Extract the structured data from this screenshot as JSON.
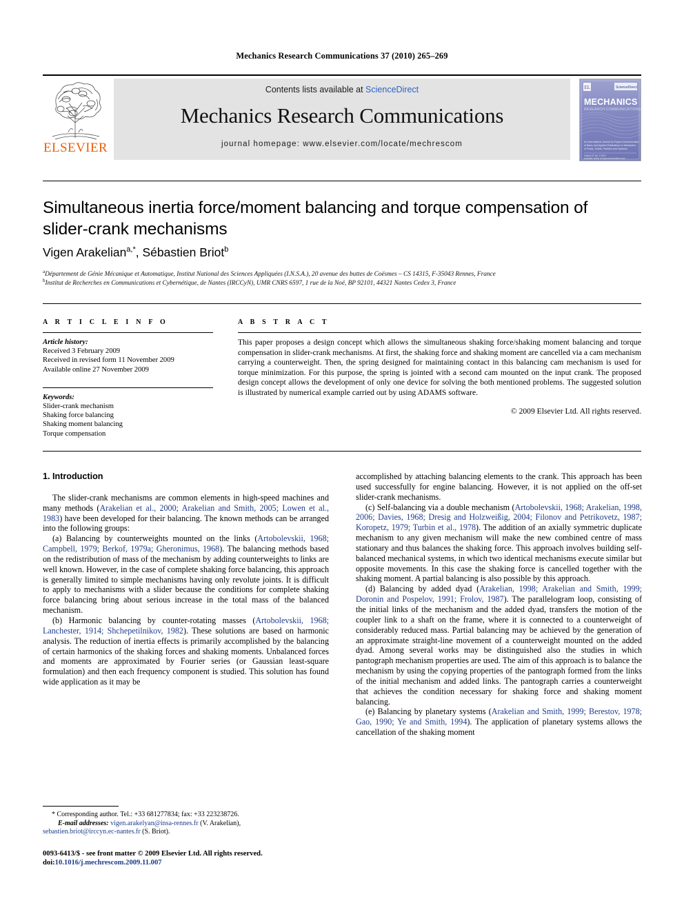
{
  "running_head": "Mechanics Research Communications 37 (2010) 265–269",
  "masthead": {
    "contents_prefix": "Contents lists available at ",
    "sciencedirect": "ScienceDirect",
    "journal_title": "Mechanics Research Communications",
    "homepage": "journal homepage: www.elsevier.com/locate/mechrescom",
    "publisher": "ELSEVIER",
    "cover": {
      "title": "MECHANICS",
      "subtitle": "RESEARCH COMMUNICATIONS",
      "blurb": "An International Journal for Rapid Communication of Basic and Applied Publications in Mechanics of Fluids, Solids, Particles and Systems",
      "badge": "ScienceDirect"
    },
    "accent_color": "#e8610a",
    "link_color": "#2b62c4",
    "band_color": "#e3e3e3"
  },
  "title": "Simultaneous inertia force/moment balancing and torque compensation of slider-crank mechanisms",
  "authors": {
    "author1": "Vigen Arakelian",
    "author1_sup": "a,*",
    "separator": ", ",
    "author2": "Sébastien Briot",
    "author2_sup": "b"
  },
  "affiliations": [
    {
      "marker": "a",
      "text": "Département de Génie Mécanique et Automatique, Institut National des Sciences Appliquées (I.N.S.A.), 20 avenue des buttes de Coësmes – CS 14315, F-35043 Rennes, France"
    },
    {
      "marker": "b",
      "text": "Institut de Recherches en Communications et Cybernétique, de Nantes (IRCCyN), UMR CNRS 6597, 1 rue de la Noë, BP 92101, 44321 Nantes Cedex 3, France"
    }
  ],
  "article_info": {
    "heading": "A R T I C L E   I N F O",
    "history_label": "Article history:",
    "history": [
      "Received 3 February 2009",
      "Received in revised form 11 November 2009",
      "Available online 27 November 2009"
    ],
    "keywords_label": "Keywords:",
    "keywords": [
      "Slider-crank mechanism",
      "Shaking force balancing",
      "Shaking moment balancing",
      "Torque compensation"
    ]
  },
  "abstract": {
    "heading": "A B S T R A C T",
    "text": "This paper proposes a design concept which allows the simultaneous shaking force/shaking moment balancing and torque compensation in slider-crank mechanisms. At first, the shaking force and shaking moment are cancelled via a cam mechanism carrying a counterweight. Then, the spring designed for maintaining contact in this balancing cam mechanism is used for torque minimization. For this purpose, the spring is jointed with a second cam mounted on the input crank. The proposed design concept allows the development of only one device for solving the both mentioned problems. The suggested solution is illustrated by numerical example carried out by using ADAMS software.",
    "copyright": "© 2009 Elsevier Ltd. All rights reserved."
  },
  "body": {
    "section_title": "1. Introduction",
    "left_column": [
      {
        "indent": true,
        "runs": [
          {
            "t": "The slider-crank mechanisms are common elements in high-speed machines and many methods ("
          },
          {
            "t": "Arakelian et al., 2000; Arakelian and Smith, 2005; Lowen et al., 1983",
            "ref": true
          },
          {
            "t": ") have been developed for their balancing. The known methods can be arranged into the following groups:"
          }
        ]
      },
      {
        "indent": true,
        "runs": [
          {
            "t": "(a) Balancing by counterweights mounted on the links ("
          },
          {
            "t": "Artobolevskii, 1968; Campbell, 1979; Berkof, 1979a; Gheronimus, 1968",
            "ref": true
          },
          {
            "t": "). The balancing methods based on the redistribution of mass of the mechanism by adding counterweights to links are well known. However, in the case of complete shaking force balancing, this approach is generally limited to simple mechanisms having only revolute joints. It is difficult to apply to mechanisms with a slider because the conditions for complete shaking force balancing bring about serious increase in the total mass of the balanced mechanism."
          }
        ]
      },
      {
        "indent": true,
        "runs": [
          {
            "t": "(b) Harmonic balancing by counter-rotating masses ("
          },
          {
            "t": "Artobolevskii, 1968; Lanchester, 1914; Shchepetilnikov, 1982",
            "ref": true
          },
          {
            "t": "). These solutions are based on harmonic analysis. The reduction of inertia effects is primarily accomplished by the balancing of certain harmonics of the shaking forces and shaking moments. Unbalanced forces and moments are approximated by Fourier series (or Gaussian least-square formulation) and then each frequency component is studied. This solution has found wide application as it may be"
          }
        ]
      }
    ],
    "right_column": [
      {
        "indent": false,
        "runs": [
          {
            "t": "accomplished by attaching balancing elements to the crank. This approach has been used successfully for engine balancing. However, it is not applied on the off-set slider-crank mechanisms."
          }
        ]
      },
      {
        "indent": true,
        "runs": [
          {
            "t": "(c) Self-balancing via a double mechanism ("
          },
          {
            "t": "Artobolevskii, 1968; Arakelian, 1998, 2006; Davies, 1968; Dresig and Holzweißig, 2004; Filonov and Petrikovetz, 1987; Koropetz, 1979; Turbin et al., 1978",
            "ref": true
          },
          {
            "t": "). The addition of an axially symmetric duplicate mechanism to any given mechanism will make the new combined centre of mass stationary and thus balances the shaking force. This approach involves building self-balanced mechanical systems, in which two identical mechanisms execute similar but opposite movements. In this case the shaking force is cancelled together with the shaking moment. A partial balancing is also possible by this approach."
          }
        ]
      },
      {
        "indent": true,
        "runs": [
          {
            "t": "(d) Balancing by added dyad ("
          },
          {
            "t": "Arakelian, 1998; Arakelian and Smith, 1999; Doronin and Pospelov, 1991; Frolov, 1987",
            "ref": true
          },
          {
            "t": "). The parallelogram loop, consisting of the initial links of the mechanism and the added dyad, transfers the motion of the coupler link to a shaft on the frame, where it is connected to a counterweight of considerably reduced mass. Partial balancing may be achieved by the generation of an approximate straight-line movement of a counterweight mounted on the added dyad. Among several works may be distinguished also the studies in which pantograph mechanism properties are used. The aim of this approach is to balance the mechanism by using the copying properties of the pantograph formed from the links of the initial mechanism and added links. The pantograph carries a counterweight that achieves the condition necessary for shaking force and shaking moment balancing."
          }
        ]
      },
      {
        "indent": true,
        "runs": [
          {
            "t": "(e) Balancing by planetary systems ("
          },
          {
            "t": "Arakelian and Smith, 1999; Berestov, 1978; Gao, 1990; Ye and Smith, 1994",
            "ref": true
          },
          {
            "t": "). The application of planetary systems allows the cancellation of the shaking moment"
          }
        ]
      }
    ]
  },
  "footnote": {
    "corresponding": "Corresponding author. Tel.: +33 681277834; fax: +33 223238726.",
    "email_label": "E-mail addresses:",
    "email1": "vigen.arakelyan@insa-rennes.fr",
    "email1_owner": "(V. Arakelian),",
    "email2": "sebastien.briot@irccyn.ec-nantes.fr",
    "email2_owner": "(S. Briot)."
  },
  "imprint": {
    "line1": "0093-6413/$ - see front matter © 2009 Elsevier Ltd. All rights reserved.",
    "doi_label": "doi:",
    "doi_value": "10.1016/j.mechrescom.2009.11.007"
  }
}
